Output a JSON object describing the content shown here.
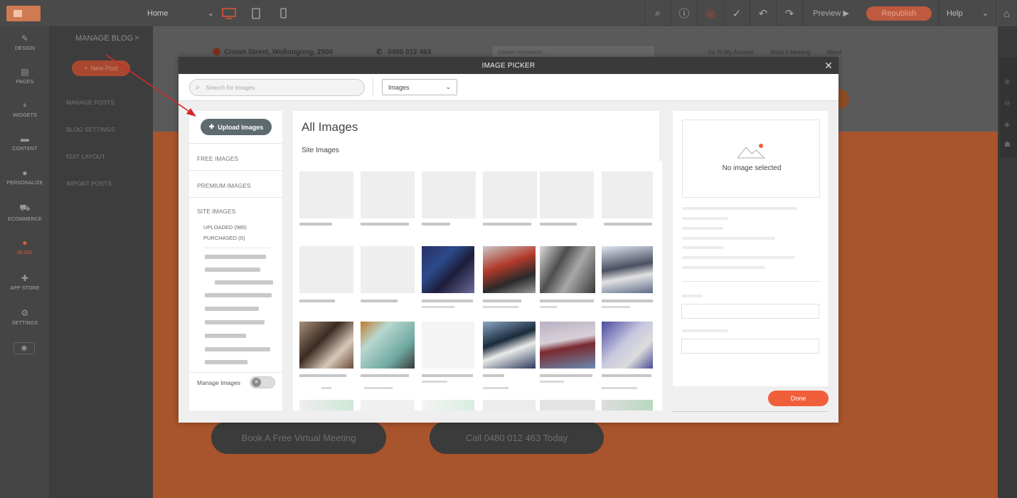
{
  "topbar": {
    "page_select": "Home",
    "preview": "Preview ▶",
    "republish": "Republish",
    "help": "Help"
  },
  "leftnav": [
    {
      "label": "DESIGN",
      "icon": "pencil-icon"
    },
    {
      "label": "PAGES",
      "icon": "pages-icon"
    },
    {
      "label": "WIDGETS",
      "icon": "plus-icon"
    },
    {
      "label": "CONTENT",
      "icon": "folder-icon"
    },
    {
      "label": "PERSONALIZE",
      "icon": "person-icon"
    },
    {
      "label": "ECOMMERCE",
      "icon": "cart-icon"
    },
    {
      "label": "BLOG",
      "icon": "chat-bubble-icon"
    },
    {
      "label": "APP STORE",
      "icon": "puzzle-icon"
    },
    {
      "label": "SETTINGS",
      "icon": "gear-icon"
    }
  ],
  "blog_panel": {
    "title": "MANAGE BLOG",
    "new_post": "New Post",
    "links": [
      "MANAGE POSTS",
      "BLOG SETTINGS",
      "EDIT LAYOUT",
      "IMPORT POSTS"
    ]
  },
  "site_header": {
    "address": "Crown Street, Wollongong, 2500",
    "phone": "0480 012 463",
    "search_placeholder": "Search Keywords...",
    "links": [
      "Go To My Account",
      "Book A Meeting",
      "About"
    ]
  },
  "ctas": [
    "Book A Free Virtual Meeting",
    "Call 0480 012 463 Today"
  ],
  "image_picker": {
    "title": "IMAGE PICKER",
    "search_placeholder": "Search for images",
    "filter": "Images",
    "upload": "Upload Images",
    "left_links": [
      "FREE IMAGES",
      "PREMIUM IMAGES",
      "SITE IMAGES"
    ],
    "site_subs": [
      "UPLOADED (985)",
      "PURCHASED (0)"
    ],
    "manage_images": "Manage Images",
    "heading": "All Images",
    "section": "Site Images",
    "no_image": "No image selected",
    "done": "Done"
  },
  "colors": {
    "accent": "#f15f3a",
    "upload_button": "#5d6a6e",
    "modal_header": "#3a3a3a"
  }
}
